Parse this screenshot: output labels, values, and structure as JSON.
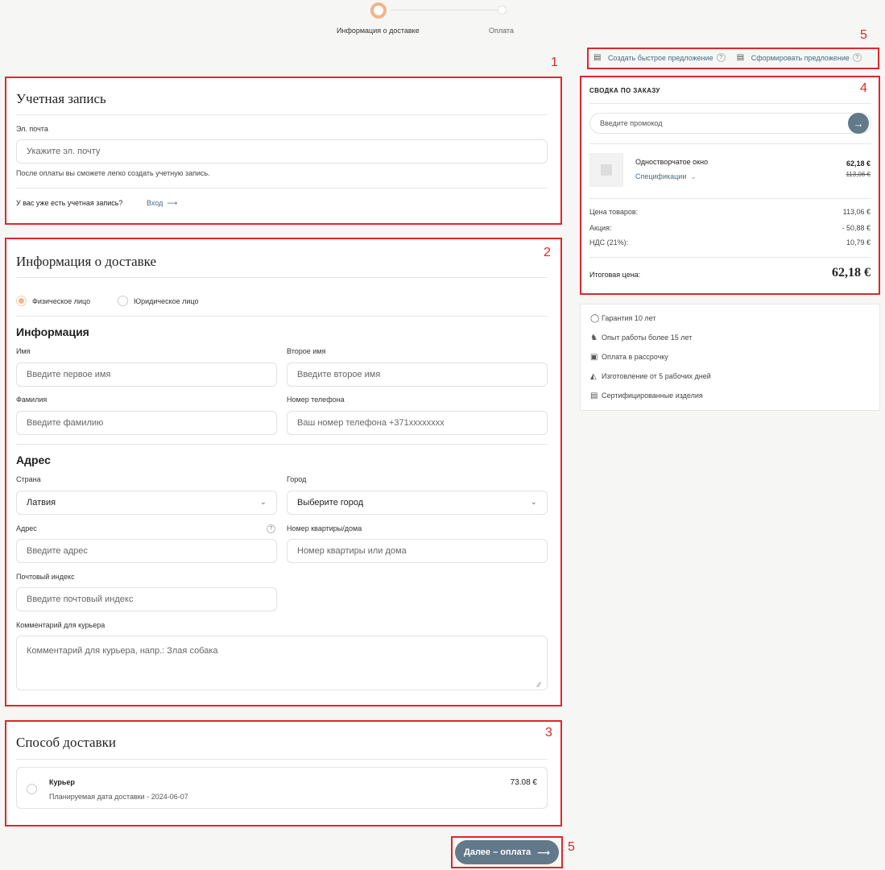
{
  "stepper": {
    "step1": "Информация о доставке",
    "step2": "Оплата"
  },
  "proposal_links": {
    "quick": "Создать быстрое предложение",
    "form": "Сформировать предложение",
    "help": "?"
  },
  "account": {
    "title": "Учетная запись",
    "email_label": "Эл. почта",
    "email_placeholder": "Укажите эл. почту",
    "note": "После оплаты вы сможете легко создать учетную запись.",
    "have_account": "У вас уже есть учетная запись?",
    "login_link": "Вход"
  },
  "delivery": {
    "title": "Информация о доставке",
    "person_private": "Физическое лицо",
    "person_legal": "Юридическое лицо",
    "info_heading": "Информация",
    "first_name_label": "Имя",
    "first_name_placeholder": "Введите первое имя",
    "second_name_label": "Второе имя",
    "second_name_placeholder": "Введите второе имя",
    "last_name_label": "Фамилия",
    "last_name_placeholder": "Введите фамилию",
    "phone_label": "Номер телефона",
    "phone_placeholder": "Ваш номер телефона +371xxxxxxxx",
    "address_heading": "Адрес",
    "country_label": "Страна",
    "country_value": "Латвия",
    "city_label": "Город",
    "city_placeholder": "Выберите город",
    "address_label": "Адрес",
    "address_placeholder": "Введите адрес",
    "apt_label": "Номер квартиры/дома",
    "apt_placeholder": "Номер квартиры или дома",
    "zip_label": "Почтовый индекс",
    "zip_placeholder": "Введите почтовый индекс",
    "comment_label": "Комментарий для курьера",
    "comment_placeholder": "Комментарий для курьера, напр.: Злая собака"
  },
  "shipping": {
    "title": "Способ доставки",
    "method_name": "Курьер",
    "method_date": "Планируемая дата доставки - 2024-06-07",
    "method_price": "73.08 €"
  },
  "summary": {
    "title": "СВОДКА ПО ЗАКАЗУ",
    "promo_placeholder": "Введите промокод",
    "product_name": "Одностворчатое окно",
    "product_specs": "Спецификации",
    "product_price": "62,18 €",
    "product_old_price": "113,06 €",
    "rows": [
      {
        "label": "Цена товаров:",
        "value": "113,06 €"
      },
      {
        "label": "Акция:",
        "value": "- 50,88 €"
      },
      {
        "label": "НДС (21%):",
        "value": "10,79 €"
      }
    ],
    "total_label": "Итоговая цена:",
    "total_value": "62,18 €"
  },
  "benefits": [
    "Гарантия 10 лет",
    "Опыт работы более 15 лет",
    "Оплата в рассрочку",
    "Изготовление от 5 рабочих дней",
    "Сертифицированные изделия"
  ],
  "next_button": "Далее – оплата",
  "annotations": [
    "1",
    "2",
    "3",
    "4",
    "5",
    "5"
  ],
  "colors": {
    "accent": "#62798a",
    "step_active": "#f2b48a",
    "annotation": "#e0262d"
  }
}
